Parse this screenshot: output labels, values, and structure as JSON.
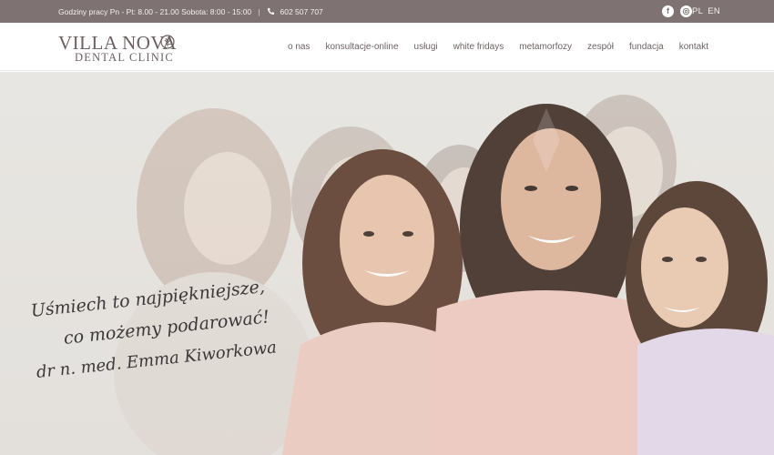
{
  "topbar": {
    "hours": "Godziny pracy Pn - Pt: 8.00 - 21.00 Sobota: 8:00 - 15:00",
    "separator": "|",
    "phone": "602 507 707",
    "social_facebook": "f",
    "social_instagram": "◎",
    "lang_pl": "PL",
    "lang_en": "EN"
  },
  "logo": {
    "line1": "VILLA NOVA",
    "line2": "DENTAL CLINIC"
  },
  "nav": [
    "o nas",
    "konsultacje-online",
    "usługi",
    "white fridays",
    "metamorfozy",
    "zespół",
    "fundacja",
    "kontakt"
  ],
  "hero": {
    "quote_line1": "Uśmiech to najpiękniejsze,",
    "quote_line2": "co możemy podarować!",
    "signature": "dr n. med. Emma Kiworkowa"
  },
  "colors": {
    "topbar_bg": "#7f7273",
    "brand": "#6b5f60",
    "hero_bg": "#e6e3df"
  }
}
